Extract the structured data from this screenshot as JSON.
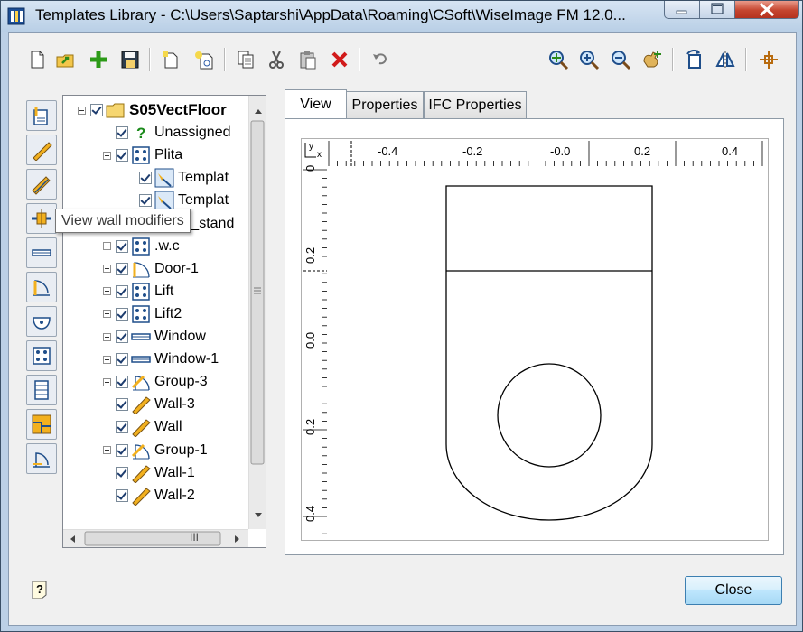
{
  "window": {
    "title": "Templates Library - C:\\Users\\Saptarshi\\AppData\\Roaming\\CSoft\\WiseImage FM 12.0..."
  },
  "toolbar": {
    "left": [
      "new-icon",
      "open-icon",
      "add-icon",
      "save-icon",
      "new-template-icon",
      "new-template-wizard-icon",
      "copy-icon",
      "cut-icon",
      "paste-icon",
      "delete-icon",
      "undo-icon"
    ],
    "right": [
      "zoom-fit-icon",
      "zoom-in-icon",
      "zoom-out-icon",
      "pan-icon",
      "rotate-icon",
      "mirror-icon",
      "insertion-point-icon"
    ]
  },
  "side_toolbar": {
    "buttons": [
      "view-properties",
      "view-walls",
      "view-wall-layers",
      "view-wall-modifiers",
      "view-windows",
      "view-doors",
      "view-plumbing",
      "view-grid-objects",
      "view-stairs",
      "view-plan",
      "view-openings"
    ],
    "tooltip": "View wall modifiers"
  },
  "tree": {
    "items": [
      {
        "label": "S05VectFloor",
        "level": 0,
        "expander": "minus",
        "icon": "folder-icon",
        "bold": true
      },
      {
        "label": "Unassigned",
        "level": 1,
        "expander": "none",
        "icon": "question-icon"
      },
      {
        "label": "Plita",
        "level": 1,
        "expander": "minus",
        "icon": "grid-object-icon"
      },
      {
        "label": "Templat",
        "level": 2,
        "expander": "none",
        "icon": "template-icon"
      },
      {
        "label": "Templat",
        "level": 2,
        "expander": "none",
        "icon": "template-icon"
      },
      {
        "label": "Wash_stand",
        "level": 1,
        "expander": "plus",
        "icon": "washstand-icon"
      },
      {
        "label": ".w.c",
        "level": 1,
        "expander": "plus",
        "icon": "grid-object-icon"
      },
      {
        "label": "Door-1",
        "level": 1,
        "expander": "plus",
        "icon": "door-icon"
      },
      {
        "label": "Lift",
        "level": 1,
        "expander": "plus",
        "icon": "grid-object-icon"
      },
      {
        "label": "Lift2",
        "level": 1,
        "expander": "plus",
        "icon": "grid-object-icon"
      },
      {
        "label": "Window",
        "level": 1,
        "expander": "plus",
        "icon": "window-icon"
      },
      {
        "label": "Window-1",
        "level": 1,
        "expander": "plus",
        "icon": "window-icon"
      },
      {
        "label": "Group-3",
        "level": 1,
        "expander": "plus",
        "icon": "group-icon"
      },
      {
        "label": "Wall-3",
        "level": 1,
        "expander": "none",
        "icon": "wall-icon"
      },
      {
        "label": "Wall",
        "level": 1,
        "expander": "none",
        "icon": "wall-icon"
      },
      {
        "label": "Group-1",
        "level": 1,
        "expander": "plus",
        "icon": "group-icon"
      },
      {
        "label": "Wall-1",
        "level": 1,
        "expander": "none",
        "icon": "wall-icon"
      },
      {
        "label": "Wall-2",
        "level": 1,
        "expander": "none",
        "icon": "wall-icon"
      }
    ],
    "hscroll_grip": "III"
  },
  "tabs": [
    {
      "label": "View",
      "active": true
    },
    {
      "label": "Properties",
      "active": false
    },
    {
      "label": "IFC Properties",
      "active": false
    }
  ],
  "ruler": {
    "corner_y": "y",
    "corner_x": "x",
    "h_labels": [
      "-0.4",
      "-0.2",
      "-0.0",
      "0.2",
      "0.4"
    ],
    "v_labels": [
      "0",
      "0.2",
      "0.0",
      "0.2",
      "0.4"
    ]
  },
  "buttons": {
    "close": "Close",
    "help_icon": "help-icon"
  }
}
